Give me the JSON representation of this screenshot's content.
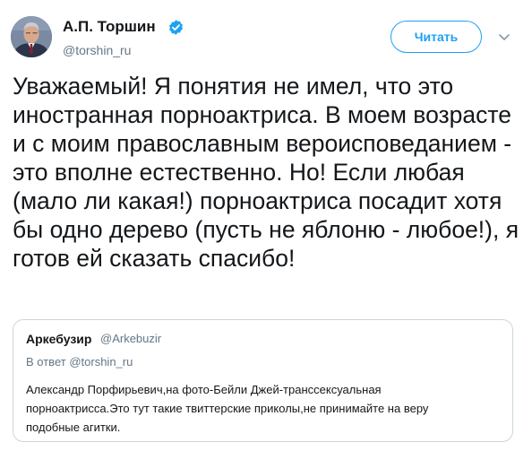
{
  "author": {
    "name": "А.П. Торшин",
    "handle": "@torshin_ru"
  },
  "actions": {
    "follow_label": "Читать"
  },
  "tweet": {
    "text": "Уважаемый! Я понятия не имел, что это иностранная порноактриса. В моем возрасте и с моим православным вероисповеданием - это вполне естественно. Но! Если любая (мало ли какая!) порноактриса посадит хотя бы одно дерево (пусть не яблоню - любое!), я готов ей сказать спасибо!"
  },
  "quoted_tweet": {
    "author_name": "Аркебузир",
    "author_handle": "@Arkebuzir",
    "reply_prefix": "В ответ",
    "reply_handle": "@torshin_ru",
    "text": "Александр Порфирьевич,на фото-Бейли Джей-транссексуальная порноактрисса.Это тут такие твиттерские приколы,не принимайте на веру подобные агитки."
  },
  "colors": {
    "accent": "#1da1f2",
    "text": "#14171a",
    "muted": "#657786",
    "border": "#ccd6dd"
  },
  "icons": {
    "verified": "verified-badge-icon",
    "caret": "chevron-down-icon",
    "avatar": "profile-photo"
  }
}
